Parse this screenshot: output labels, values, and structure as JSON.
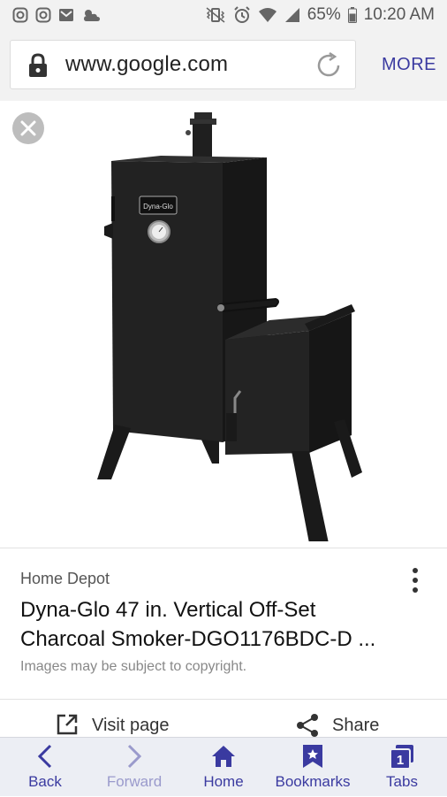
{
  "status_bar": {
    "icons_left": [
      "instagram-icon",
      "instagram-icon",
      "gmail-icon",
      "weather-icon"
    ],
    "icons_right": [
      "vibrate-icon",
      "alarm-icon",
      "wifi-icon",
      "signal-icon"
    ],
    "battery": "65%",
    "time": "10:20 AM"
  },
  "browser": {
    "url": "www.google.com",
    "more_label": "MORE"
  },
  "result": {
    "source": "Home Depot",
    "title_line1": "Dyna-Glo 47 in. Vertical Off-Set",
    "title_line2": "Charcoal Smoker-DGO1176BDC-D ...",
    "copyright": "Images may be subject to copyright.",
    "brand_badge": "Dyna-Glo"
  },
  "actions": {
    "visit": "Visit page",
    "share": "Share"
  },
  "nav": {
    "back": "Back",
    "forward": "Forward",
    "home": "Home",
    "bookmarks": "Bookmarks",
    "tabs": "Tabs",
    "tabs_count": "1"
  },
  "colors": {
    "accent": "#3a3aa0",
    "status_bg": "#f2f2f2",
    "nav_bg": "#eceef4"
  }
}
